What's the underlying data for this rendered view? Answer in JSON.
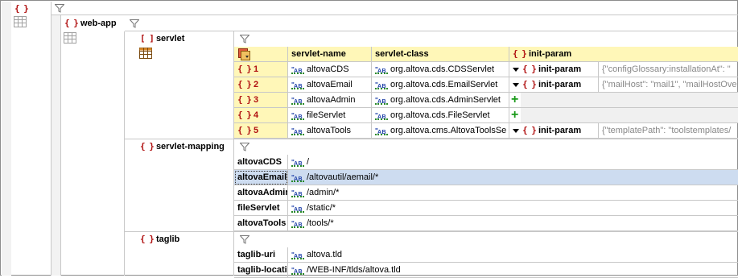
{
  "root": {
    "brace": "{ }"
  },
  "webapp": {
    "brace": "{ }",
    "label": "web-app"
  },
  "servlet": {
    "brace": "[ ]",
    "label": "servlet",
    "columns": [
      "servlet-name",
      "servlet-class",
      "init-param"
    ],
    "init_param_brace": "{ }",
    "rows": [
      {
        "brace": "{ }",
        "index": "1",
        "name": "altovaCDS",
        "class": "org.altova.cds.CDSServlet",
        "init_label": "init-param",
        "init_value": "{\"configGlossary:installationAt\": \""
      },
      {
        "brace": "{ }",
        "index": "2",
        "name": "altovaEmail",
        "class": "org.altova.cds.EmailServlet",
        "init_label": "init-param",
        "init_value": "{\"mailHost\": \"mail1\", \"mailHostOve"
      },
      {
        "brace": "{ }",
        "index": "3",
        "name": "altovaAdmin",
        "class": "org.altova.cds.AdminServlet",
        "init_label": "",
        "init_value": ""
      },
      {
        "brace": "{ }",
        "index": "4",
        "name": "fileServlet",
        "class": "org.altova.cds.FileServlet",
        "init_label": "",
        "init_value": ""
      },
      {
        "brace": "{ }",
        "index": "5",
        "name": "altovaTools",
        "class": "org.altova.cms.AltovaToolsSe",
        "init_label": "init-param",
        "init_value": "{\"templatePath\": \"toolstemplates/"
      }
    ]
  },
  "mapping": {
    "brace": "{ }",
    "label": "servlet-mapping",
    "rows": [
      {
        "key": "altovaCDS",
        "value": "/"
      },
      {
        "key": "altovaEmail",
        "value": "/altovautil/aemail/*"
      },
      {
        "key": "altovaAdmin",
        "value": "/admin/*"
      },
      {
        "key": "fileServlet",
        "value": "/static/*"
      },
      {
        "key": "altovaTools",
        "value": "/tools/*"
      }
    ]
  },
  "taglib": {
    "brace": "{ }",
    "label": "taglib",
    "rows": [
      {
        "key": "taglib-uri",
        "value": "altova.tld"
      },
      {
        "key": "taglib-location",
        "value": "/WEB-INF/tlds/altova.tld"
      }
    ]
  },
  "icons": {
    "type": "string-type-icon",
    "plus": "add-icon",
    "filter": "filter-icon"
  },
  "ab_text": "AB",
  "plus_glyph": "+"
}
